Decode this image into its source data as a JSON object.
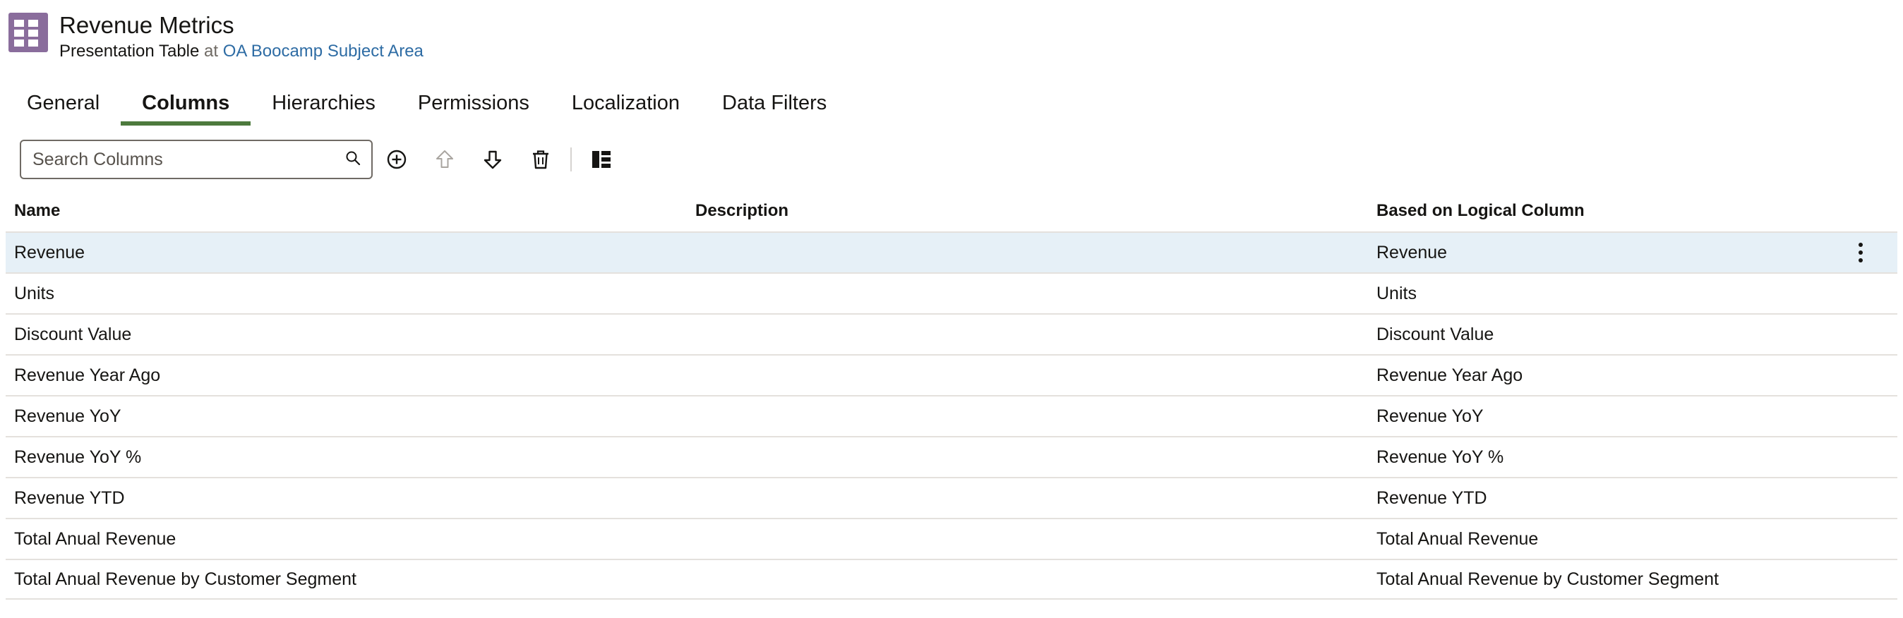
{
  "header": {
    "icon": "table-grid-icon",
    "icon_color": "#8a6d9c",
    "title": "Revenue Metrics",
    "subtitle_type": "Presentation Table",
    "subtitle_at": "at",
    "subtitle_link": "OA Boocamp Subject Area"
  },
  "tabs": [
    {
      "label": "General",
      "active": false
    },
    {
      "label": "Columns",
      "active": true
    },
    {
      "label": "Hierarchies",
      "active": false
    },
    {
      "label": "Permissions",
      "active": false
    },
    {
      "label": "Localization",
      "active": false
    },
    {
      "label": "Data Filters",
      "active": false
    }
  ],
  "toolbar": {
    "search_placeholder": "Search Columns",
    "search_value": "",
    "icons": [
      "add-circle-icon",
      "move-up-icon",
      "move-down-icon",
      "delete-icon",
      "column-layout-icon"
    ]
  },
  "table": {
    "headers": {
      "name": "Name",
      "description": "Description",
      "based_on": "Based on Logical Column"
    },
    "rows": [
      {
        "name": "Revenue",
        "description": "",
        "based_on": "Revenue"
      },
      {
        "name": "Units",
        "description": "",
        "based_on": "Units"
      },
      {
        "name": "Discount Value",
        "description": "",
        "based_on": "Discount Value"
      },
      {
        "name": "Revenue Year Ago",
        "description": "",
        "based_on": "Revenue Year Ago"
      },
      {
        "name": "Revenue YoY",
        "description": "",
        "based_on": "Revenue YoY"
      },
      {
        "name": "Revenue YoY %",
        "description": "",
        "based_on": "Revenue YoY %"
      },
      {
        "name": "Revenue YTD",
        "description": "",
        "based_on": "Revenue YTD"
      },
      {
        "name": "Total Anual Revenue",
        "description": "",
        "based_on": "Total Anual Revenue"
      },
      {
        "name": "Total Anual Revenue by Customer Segment",
        "description": "",
        "based_on": "Total Anual Revenue by Customer Segment"
      }
    ]
  },
  "colors": {
    "active_tab_underline": "#4d7a3d",
    "selected_row": "#e6f0f7",
    "link": "#2e6ca4"
  }
}
